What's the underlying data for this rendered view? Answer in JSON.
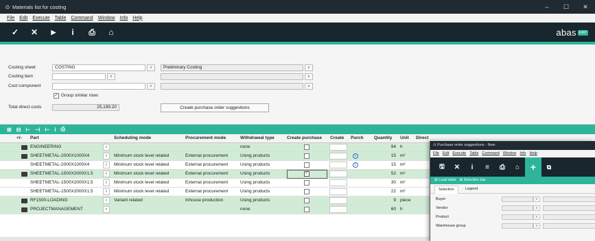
{
  "window": {
    "title": "Materials list for costing",
    "controls": [
      "–",
      "☐",
      "✕"
    ]
  },
  "menu": [
    "File",
    "Edit",
    "Execute",
    "Table",
    "Command",
    "Window",
    "Info",
    "Help"
  ],
  "toolbar": {
    "icons": [
      "check-icon",
      "close-icon",
      "play-icon",
      "info-icon",
      "print-icon",
      "home-icon"
    ],
    "glyphs": [
      "✓",
      "✕",
      "▶",
      "i",
      "⎙",
      "⌂"
    ],
    "logo": "abas",
    "logo_badge": "ERP"
  },
  "header": {
    "costing_sheet_label": "Costing sheet",
    "costing_sheet_value": "COSTING",
    "costing_sheet_desc": "Preliminary Costing",
    "costing_item_label": "Costing item",
    "cost_component_label": "Cost component",
    "group_similar_label": "Group similar rows",
    "group_similar_checked": "✓",
    "total_direct_costs_label": "Total direct costs",
    "total_direct_costs_value": "25,199.20",
    "create_po_button": "Create purchase order suggestions"
  },
  "table": {
    "columns": [
      "+/-",
      "Part",
      "Scheduling mode",
      "Procurement mode",
      "Withdrawal type",
      "Create purchase",
      "Create",
      "Purch",
      "Quantity",
      "Unit",
      "Direct"
    ],
    "rows": [
      {
        "part": "ENGINEERING",
        "scheduling": "",
        "procurement": "",
        "withdrawal": "none",
        "quantity": "94",
        "unit": "h",
        "folder": true,
        "info": false,
        "style": "g",
        "checked": false
      },
      {
        "part": "SHEETMETAL-2000X1000X4",
        "scheduling": "Minimum stock level related",
        "procurement": "External procurement",
        "withdrawal": "Using products",
        "quantity": "15",
        "unit": "m²",
        "folder": true,
        "info": true,
        "style": "g",
        "checked": false
      },
      {
        "part": "SHEETMETAL-2000X1000X4",
        "scheduling": "Minimum stock level related",
        "procurement": "External procurement",
        "withdrawal": "Using products",
        "quantity": "15",
        "unit": "m²",
        "folder": false,
        "info": true,
        "style": "w",
        "checked": false
      },
      {
        "part": "SHEETMETAL-1500X2000X1.5",
        "scheduling": "Minimum stock level related",
        "procurement": "External procurement",
        "withdrawal": "Using products",
        "quantity": "52",
        "unit": "m²",
        "folder": true,
        "info": false,
        "style": "g",
        "checked": true
      },
      {
        "part": "SHEETMETAL-1500X2000X1.5",
        "scheduling": "Minimum stock level related",
        "procurement": "External procurement",
        "withdrawal": "Using products",
        "quantity": "30",
        "unit": "m²",
        "folder": false,
        "info": false,
        "style": "w",
        "checked": false
      },
      {
        "part": "SHEETMETAL-1500X2000X1.5",
        "scheduling": "Minimum stock level related",
        "procurement": "External procurement",
        "withdrawal": "Using products",
        "quantity": "22",
        "unit": "m²",
        "folder": false,
        "info": false,
        "style": "w",
        "checked": false
      },
      {
        "part": "RF1500-LOADING",
        "scheduling": "Variant related",
        "procurement": "Inhouse production",
        "withdrawal": "Using products",
        "quantity": "9",
        "unit": "piece",
        "folder": true,
        "info": false,
        "style": "g",
        "checked": false
      },
      {
        "part": "PROJECTMANAGEMENT",
        "scheduling": "",
        "procurement": "",
        "withdrawal": "none",
        "quantity": "60",
        "unit": "h",
        "folder": true,
        "info": false,
        "style": "g",
        "checked": false
      }
    ]
  },
  "overlay": {
    "title": "Purchase order suggestions - New",
    "menu": [
      "File",
      "Edit",
      "Execute",
      "Table",
      "Command",
      "Window",
      "Info",
      "Help"
    ],
    "toolbar_glyphs": [
      "🖫",
      "✕",
      "i",
      "≡",
      "⎙",
      "⌂",
      "+",
      "⧉"
    ],
    "load_table": "Load table",
    "selection_bar": "Selection bar",
    "tabs": [
      "Selection",
      "Legend"
    ],
    "fields": [
      "Buyer",
      "Vendor",
      "Product",
      "Warehouse group"
    ]
  },
  "colors": {
    "accent": "#2db59b",
    "dark_toolbar": "#18262e",
    "row_green": "#d1ecd6"
  }
}
